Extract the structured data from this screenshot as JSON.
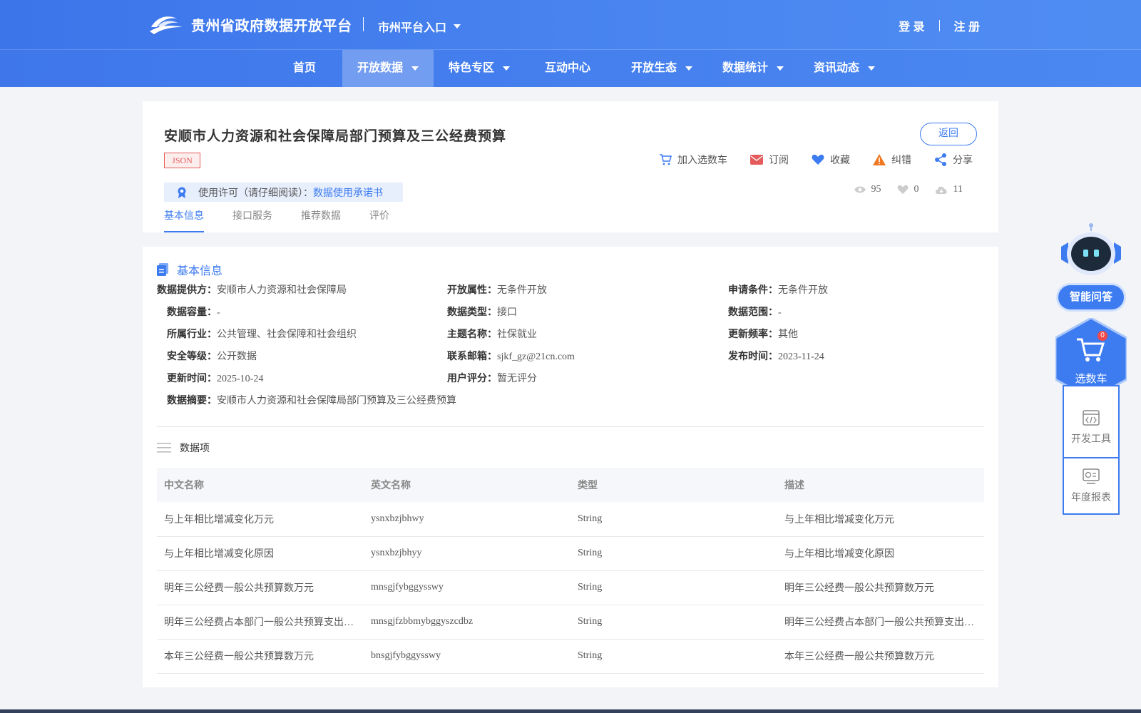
{
  "header": {
    "site_title": "贵州省政府数据开放平台",
    "city_entry": "市州平台入口",
    "login": "登 录",
    "register": "注 册"
  },
  "nav": [
    {
      "label": "首页"
    },
    {
      "label": "开放数据",
      "active": true
    },
    {
      "label": "特色专区"
    },
    {
      "label": "互动中心"
    },
    {
      "label": "开放生态"
    },
    {
      "label": "数据统计"
    },
    {
      "label": "资讯动态"
    }
  ],
  "dataset": {
    "title": "安顺市人力资源和社会保障局部门预算及三公经费预算",
    "format_badge": "JSON",
    "back_label": "返回",
    "actions": {
      "cart": "加入选数车",
      "subscribe": "订阅",
      "favorite": "收藏",
      "report": "纠错",
      "share": "分享"
    },
    "license_prefix": "使用许可（请仔细阅读）：",
    "license_link": "数据使用承诺书",
    "stats": {
      "views": "95",
      "likes": "0",
      "downloads": "11"
    },
    "tabs": [
      "基本信息",
      "接口服务",
      "推荐数据",
      "评价"
    ]
  },
  "basic_info": {
    "section_title": "基本信息",
    "provider_label": "数据提供方：",
    "provider": "安顺市人力资源和社会保障局",
    "open_attr_label": "开放属性：",
    "open_attr": "无条件开放",
    "apply_cond_label": "申请条件：",
    "apply_cond": "无条件开放",
    "capacity_label": "数据容量：",
    "capacity": "-",
    "data_type_label": "数据类型：",
    "data_type": "接口",
    "scope_label": "数据范围：",
    "scope": "-",
    "industry_label": "所属行业：",
    "industry": "公共管理、社会保障和社会组织",
    "theme_label": "主题名称：",
    "theme": "社保就业",
    "frequency_label": "更新频率：",
    "frequency": "其他",
    "security_label": "安全等级：",
    "security": "公开数据",
    "email_label": "联系邮箱：",
    "email": "sjkf_gz@21cn.com",
    "publish_label": "发布时间：",
    "publish": "2023-11-24",
    "updated_label": "更新时间：",
    "updated": "2025-10-24",
    "rating_label": "用户评分：",
    "rating": "暂无评分",
    "summary_label": "数据摘要：",
    "summary": "安顺市人力资源和社会保障局部门预算及三公经费预算"
  },
  "data_items": {
    "title": "数据项",
    "columns": [
      "中文名称",
      "英文名称",
      "类型",
      "描述"
    ],
    "rows": [
      [
        "与上年相比增减变化万元",
        "ysnxbzjbhwy",
        "String",
        "与上年相比增减变化万元"
      ],
      [
        "与上年相比增减变化原因",
        "ysnxbzjbhyy",
        "String",
        "与上年相比增减变化原因"
      ],
      [
        "明年三公经费一般公共预算数万元",
        "mnsgjfybggysswy",
        "String",
        "明年三公经费一般公共预算数万元"
      ],
      [
        "明年三公经费占本部门一般公共预算支出总额比例",
        "mnsgjfzbbmybggyszcdbz",
        "String",
        "明年三公经费占本部门一般公共预算支出总额比例"
      ],
      [
        "本年三公经费一般公共预算数万元",
        "bnsgjfybggysswy",
        "String",
        "本年三公经费一般公共预算数万元"
      ]
    ]
  },
  "sidebar": {
    "qa_label": "智能问答",
    "cart_label": "选数车",
    "cart_count": "0",
    "dev_tools": "开发工具",
    "annual_report": "年度报表"
  },
  "colors": {
    "primary": "#3c7bf0",
    "badge_red": "#e55b5b",
    "header": "#4a86f0"
  }
}
